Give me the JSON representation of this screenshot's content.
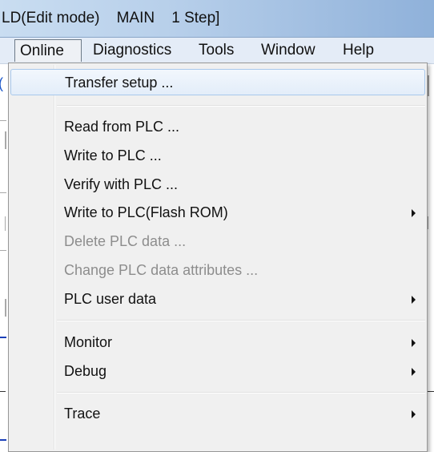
{
  "window": {
    "title": "LD(Edit mode)    MAIN    1 Step]"
  },
  "menubar": {
    "items": [
      {
        "label": "Online",
        "active": true
      },
      {
        "label": "Diagnostics",
        "active": false
      },
      {
        "label": "Tools",
        "active": false
      },
      {
        "label": "Window",
        "active": false
      },
      {
        "label": "Help",
        "active": false
      }
    ]
  },
  "online_menu": {
    "items": [
      {
        "label": "Transfer setup ...",
        "enabled": true,
        "submenu": false,
        "highlighted": true
      },
      {
        "label": "Read from PLC ...",
        "enabled": true,
        "submenu": false
      },
      {
        "label": "Write to PLC ...",
        "enabled": true,
        "submenu": false
      },
      {
        "label": "Verify with PLC ...",
        "enabled": true,
        "submenu": false
      },
      {
        "label": "Write to PLC(Flash ROM)",
        "enabled": true,
        "submenu": true
      },
      {
        "label": "Delete PLC data ...",
        "enabled": false,
        "submenu": false
      },
      {
        "label": "Change PLC data attributes ...",
        "enabled": false,
        "submenu": false
      },
      {
        "label": "PLC user data",
        "enabled": true,
        "submenu": true
      },
      {
        "label": "Monitor",
        "enabled": true,
        "submenu": true
      },
      {
        "label": "Debug",
        "enabled": true,
        "submenu": true
      },
      {
        "label": "Trace",
        "enabled": true,
        "submenu": true
      }
    ]
  },
  "colors": {
    "highlight_border": "#a8c8ec",
    "disabled_text": "#8d8d8d",
    "menu_background": "#f0f0f0"
  }
}
